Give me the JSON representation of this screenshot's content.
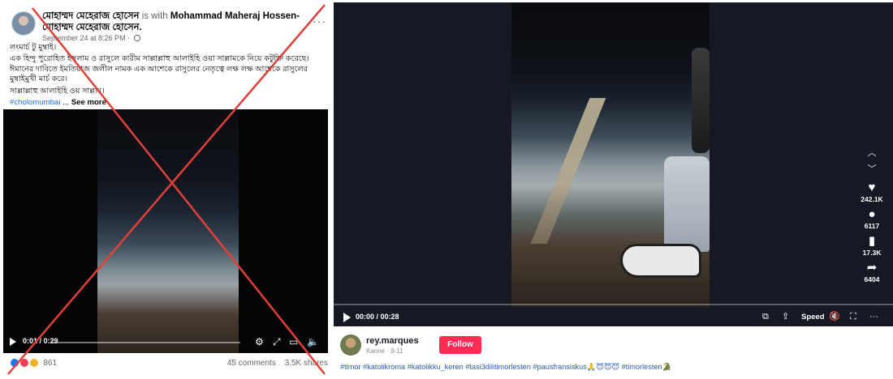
{
  "facebook": {
    "author": "মোহাম্মদ মেহেরাজ হোসেন",
    "with_text": " is with ",
    "tagged": "Mohammad Maheraj Hossen-মোহাম্মদ মেহেরাজ হোসেন.",
    "timestamp": "September 24 at 8:26 PM ·",
    "more_label": "···",
    "lines": [
      "লংমার্চ টু মুম্বাই।",
      "এক হিন্দু পুরোহিত ইসলাম ও রাসুলে কারীম সাল্লাল্লাহু আলাইহি ওয়া সাল্লামকে নিয়ে কটুক্তি করেছে। ঈমানের দাবিতে ইমতিয়াজ জলীল নামক এক আশেকে রাসুলের নেতৃত্বে লক্ষ লক্ষ আশেকে রাসুলের মুম্বাইমুখী মার্চ করে।",
      "সাল্লাল্লাহু আলাইহি ওয় সাল্লাম।"
    ],
    "hashtag": "#cholomumbai",
    "ellipsis": " ... ",
    "see_more": "See more",
    "video_time": "0:01 / 0:29",
    "reaction_count": "861",
    "comments": "45 comments",
    "shares": "3.5K shares",
    "cross_color": "#e0403a",
    "icons": [
      "play-icon",
      "settings-icon",
      "expand-icon",
      "pip-icon",
      "volume-icon"
    ]
  },
  "tiktok": {
    "time": "00:00 / 00:28",
    "speed_label": "Speed",
    "actions": [
      {
        "icon": "heart-icon",
        "glyph": "♥",
        "count": "242.1K"
      },
      {
        "icon": "comment-icon",
        "glyph": "●",
        "count": "6117"
      },
      {
        "icon": "bookmark-icon",
        "glyph": "▮",
        "count": "17.3K"
      },
      {
        "icon": "share-icon",
        "glyph": "➦",
        "count": "6404"
      }
    ],
    "username": "rey.marques",
    "subline": "Kanne · 9-11",
    "follow_label": "Follow",
    "caption": "#timor #katolikroma #katolikku_keren #tasi3dilitimorlesten #pausfransiskus🙏😇😇😇 #timorlesten🐊",
    "accent": "#fe2c55"
  }
}
